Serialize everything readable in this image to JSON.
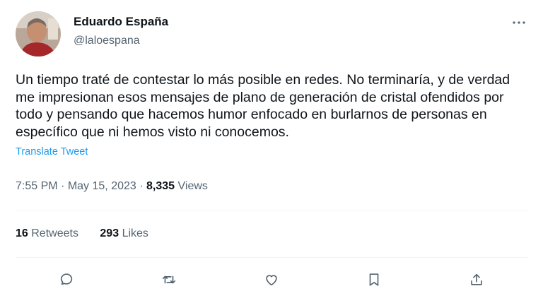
{
  "author": {
    "name": "Eduardo España",
    "handle": "@laloespana"
  },
  "tweet": {
    "text": "Un tiempo traté de contestar lo más posible en redes. No terminaría, y de verdad me impresionan esos mensajes de plano de generación de cristal ofendidos por todo y pensando que hacemos humor enfocado en burlarnos de personas en específico que ni hemos visto ni conocemos.",
    "translate_label": "Translate Tweet"
  },
  "meta": {
    "time": "7:55 PM",
    "separator": "·",
    "date": "May 15, 2023",
    "views_count": "8,335",
    "views_label": "Views"
  },
  "stats": {
    "retweets_count": "16",
    "retweets_label": "Retweets",
    "likes_count": "293",
    "likes_label": "Likes"
  },
  "actions": [
    "reply-icon",
    "retweet-icon",
    "like-icon",
    "bookmark-icon",
    "share-icon"
  ],
  "colors": {
    "text": "#0f1419",
    "secondary": "#536471",
    "link": "#1d9bf0",
    "divider": "#eff3f4"
  }
}
